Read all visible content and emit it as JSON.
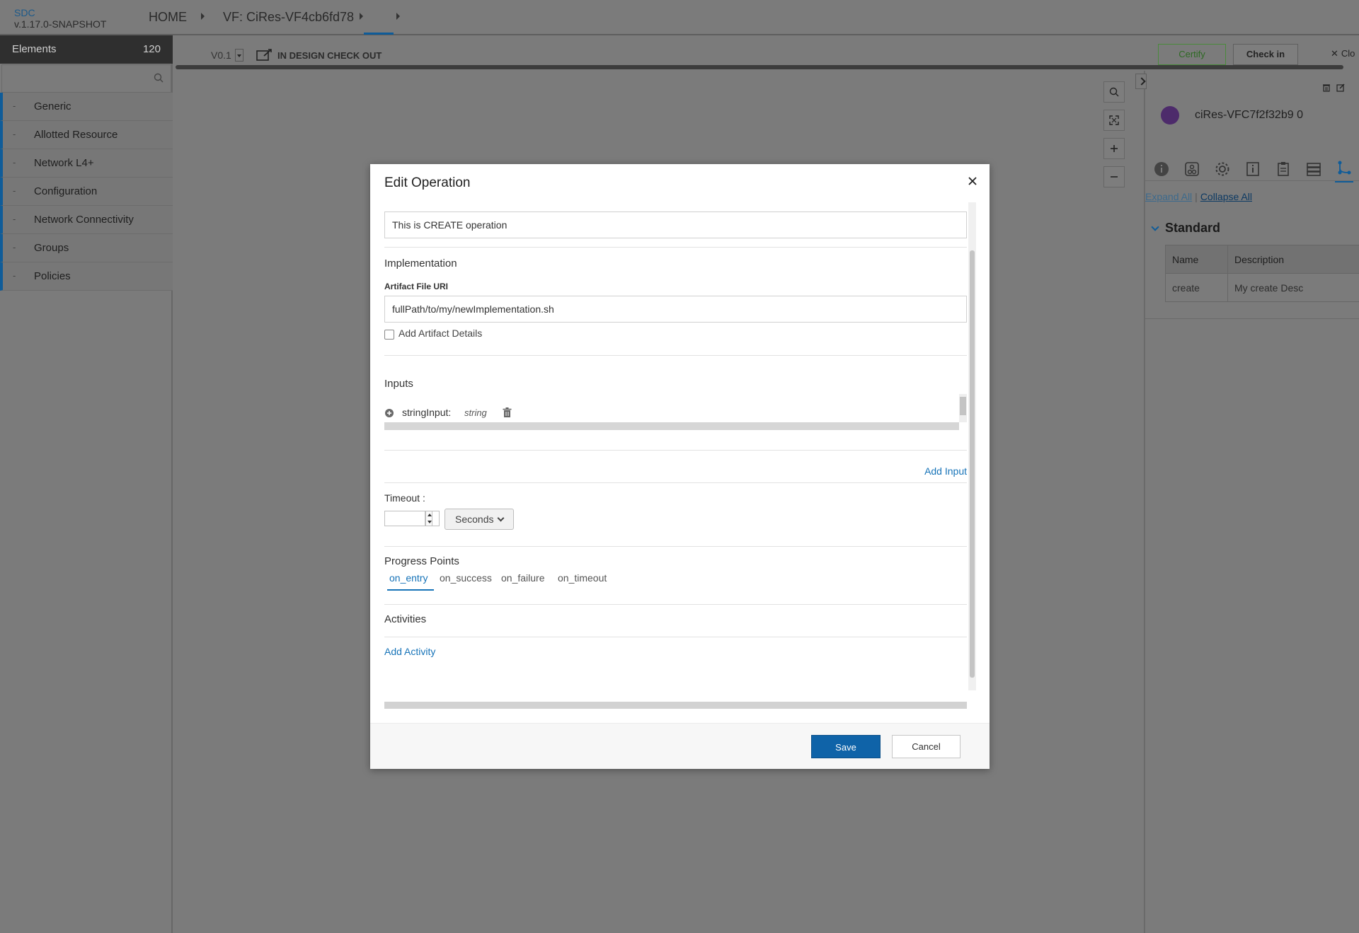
{
  "app": {
    "name": "SDC",
    "version": "v.1.17.0-SNAPSHOT"
  },
  "breadcrumb": {
    "home": "HOME",
    "resource": "VF: CiRes-VF4cb6fd78"
  },
  "palette": {
    "title": "Elements",
    "count": "120",
    "categories": [
      {
        "label": "Generic"
      },
      {
        "label": "Allotted Resource"
      },
      {
        "label": "Network L4+"
      },
      {
        "label": "Configuration"
      },
      {
        "label": "Network Connectivity"
      },
      {
        "label": "Groups"
      },
      {
        "label": "Policies"
      }
    ]
  },
  "toolbar": {
    "version": "V0.1",
    "status": "IN DESIGN CHECK OUT",
    "certify": "Certify",
    "checkin": "Check in",
    "close": "Clo"
  },
  "right_panel": {
    "instance_name": "ciRes-VFC7f2f32b9 0",
    "expand_all": "Expand All",
    "collapse_all": "Collapse All",
    "section": "Standard",
    "table": {
      "headers": [
        "Name",
        "Description"
      ],
      "rows": [
        [
          "create",
          "My create Desc"
        ]
      ]
    }
  },
  "modal": {
    "title": "Edit Operation",
    "description_value": "This is CREATE operation",
    "implementation_label": "Implementation",
    "artifact_uri_label": "Artifact File URI",
    "artifact_uri_value": "fullPath/to/my/newImplementation.sh",
    "add_artifact_details": "Add Artifact Details",
    "inputs_label": "Inputs",
    "inputs": [
      {
        "name": "stringInput:",
        "type": "string"
      }
    ],
    "add_input": "Add Input",
    "timeout_label": "Timeout :",
    "timeout_value": "",
    "timeout_unit": "Seconds",
    "progress_label": "Progress Points",
    "progress_tabs": [
      "on_entry",
      "on_success",
      "on_failure",
      "on_timeout"
    ],
    "active_progress_tab": "on_entry",
    "activities_label": "Activities",
    "add_activity": "Add Activity",
    "save": "Save",
    "cancel": "Cancel"
  },
  "colors": {
    "accent": "#0f63a8",
    "link": "#1673b8",
    "backdrop": "#7b7b7b",
    "certify": "#4a8a3c"
  },
  "icons": {
    "search": "search-icon",
    "zoom_fit": "fit-icon",
    "zoom_in": "plus-icon",
    "zoom_out": "minus-icon",
    "close": "close-icon",
    "trash": "trash-icon",
    "edit": "edit-icon",
    "add": "plus-circle-icon"
  }
}
